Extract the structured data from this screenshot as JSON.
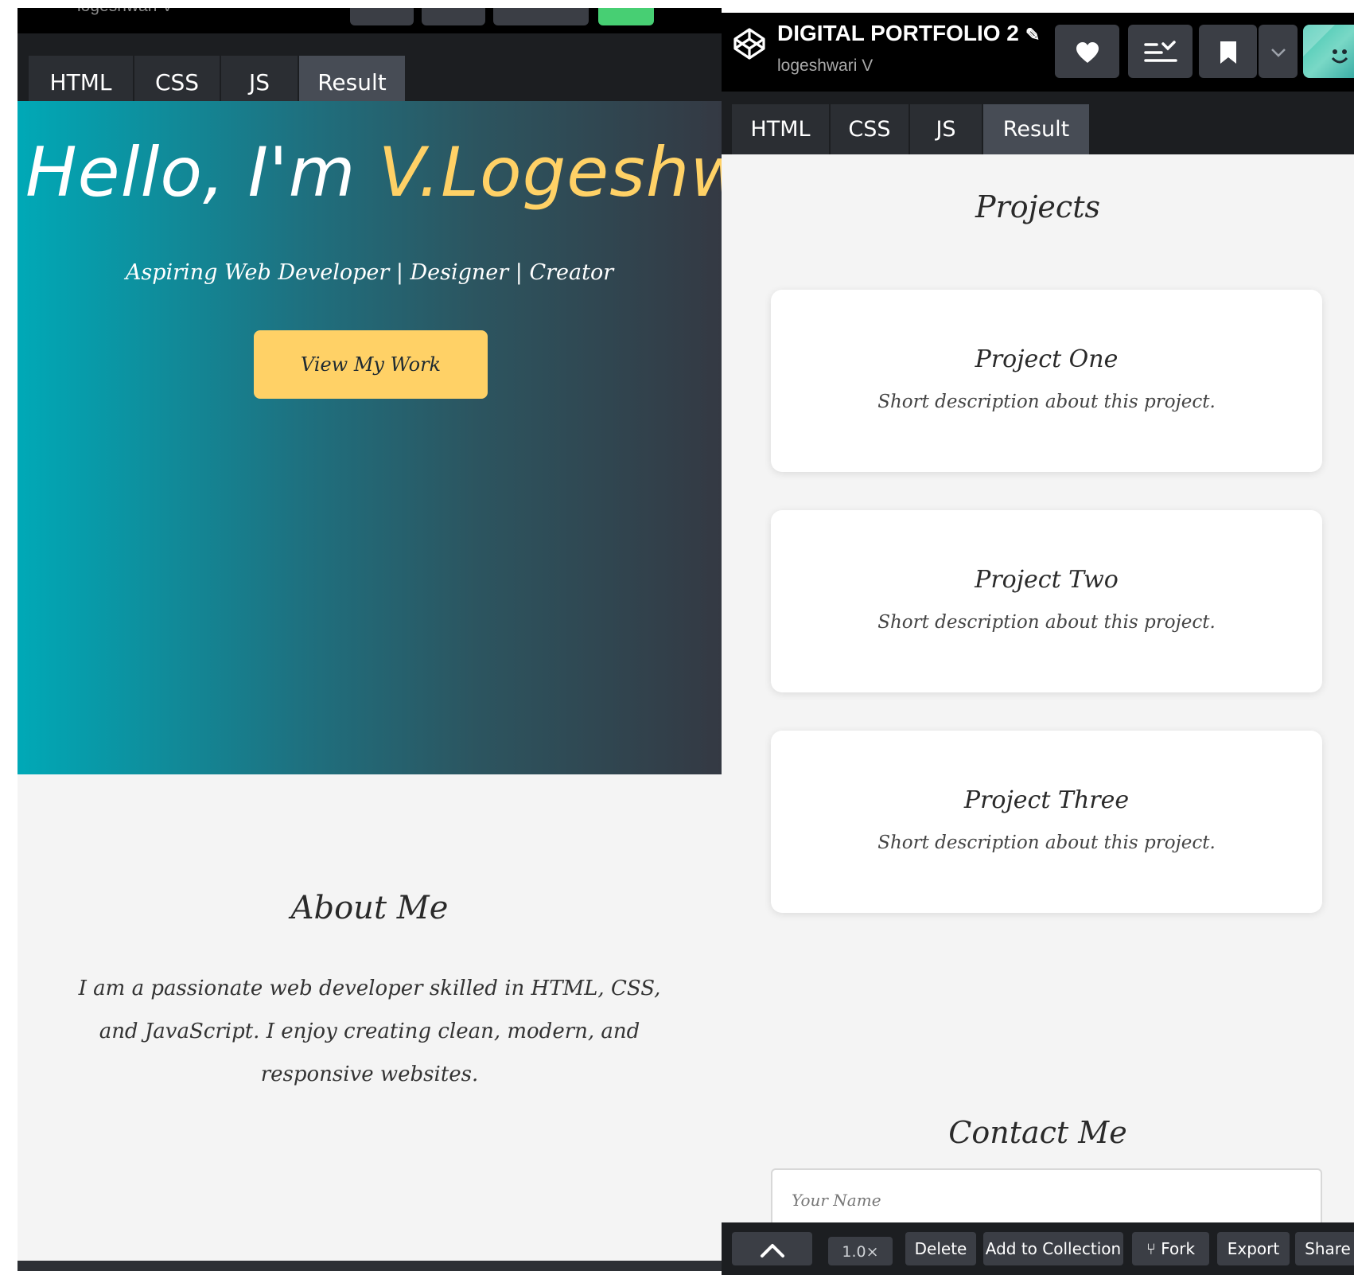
{
  "left": {
    "author": "logeshwari V",
    "tabs": [
      "HTML",
      "CSS",
      "JS",
      "Result"
    ],
    "active_tab": "Result",
    "hero": {
      "greeting": "Hello, I'm",
      "name": "V.Logeshwari",
      "tagline": "Aspiring Web Developer | Designer | Creator",
      "cta_label": "View My Work"
    },
    "about": {
      "title": "About Me",
      "text": "I am a passionate web developer skilled in HTML, CSS, and JavaScript. I enjoy creating clean, modern, and responsive websites."
    }
  },
  "right": {
    "pen_title": "DIGITAL PORTFOLIO 2",
    "author": "logeshwari V",
    "icons": {
      "logo": "codepen-logo-icon",
      "edit": "pencil-icon",
      "like": "heart-icon",
      "layout": "layout-menu-icon",
      "bookmark": "bookmark-icon",
      "dropdown": "chevron-down-icon",
      "avatar": "user-avatar"
    },
    "tabs": [
      "HTML",
      "CSS",
      "JS",
      "Result"
    ],
    "active_tab": "Result",
    "projects": {
      "title": "Projects",
      "items": [
        {
          "title": "Project One",
          "desc": "Short description about this project."
        },
        {
          "title": "Project Two",
          "desc": "Short description about this project."
        },
        {
          "title": "Project Three",
          "desc": "Short description about this project."
        }
      ]
    },
    "contact": {
      "title": "Contact Me",
      "name_placeholder": "Your Name"
    },
    "footer": {
      "zoom": "1.0×",
      "delete": "Delete",
      "add_to_collection": "Add to Collection",
      "fork": "Fork",
      "export": "Export",
      "share": "Share"
    }
  },
  "colors": {
    "accent_yellow": "#ffd166",
    "hero_gradient_start": "#00a9b7",
    "hero_gradient_end": "#343943",
    "editor_bar": "#1c1e21",
    "header_bg": "#000000"
  }
}
